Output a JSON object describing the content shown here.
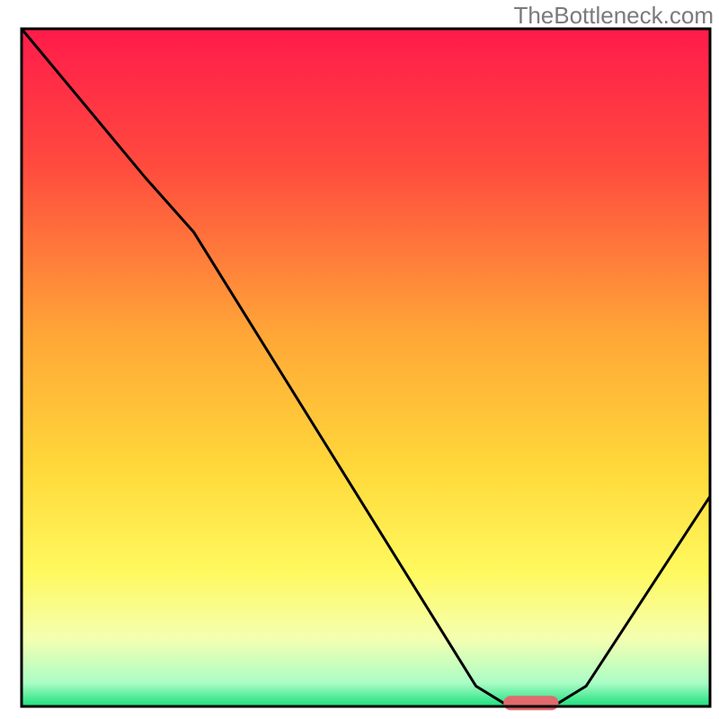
{
  "watermark": "TheBottleneck.com",
  "chart_data": {
    "type": "line",
    "title": "",
    "xlabel": "",
    "ylabel": "",
    "xlim": [
      0,
      100
    ],
    "ylim": [
      0,
      100
    ],
    "gradient_stops": [
      {
        "pos": 0.0,
        "color": "#ff1b4b"
      },
      {
        "pos": 0.2,
        "color": "#ff4a3e"
      },
      {
        "pos": 0.45,
        "color": "#ffa637"
      },
      {
        "pos": 0.65,
        "color": "#ffd93a"
      },
      {
        "pos": 0.8,
        "color": "#fff95e"
      },
      {
        "pos": 0.9,
        "color": "#f4ffb0"
      },
      {
        "pos": 0.965,
        "color": "#abfdc6"
      },
      {
        "pos": 1.0,
        "color": "#1be07c"
      }
    ],
    "curve": [
      {
        "x": 0,
        "y": 100
      },
      {
        "x": 18,
        "y": 78
      },
      {
        "x": 25,
        "y": 70
      },
      {
        "x": 66,
        "y": 3
      },
      {
        "x": 70,
        "y": 0.5
      },
      {
        "x": 78,
        "y": 0.5
      },
      {
        "x": 82,
        "y": 3
      },
      {
        "x": 100,
        "y": 31
      }
    ],
    "marker": {
      "x_start": 70,
      "x_end": 78,
      "y": 0.5,
      "color": "#e16a6e"
    },
    "frame_color": "#000000"
  }
}
